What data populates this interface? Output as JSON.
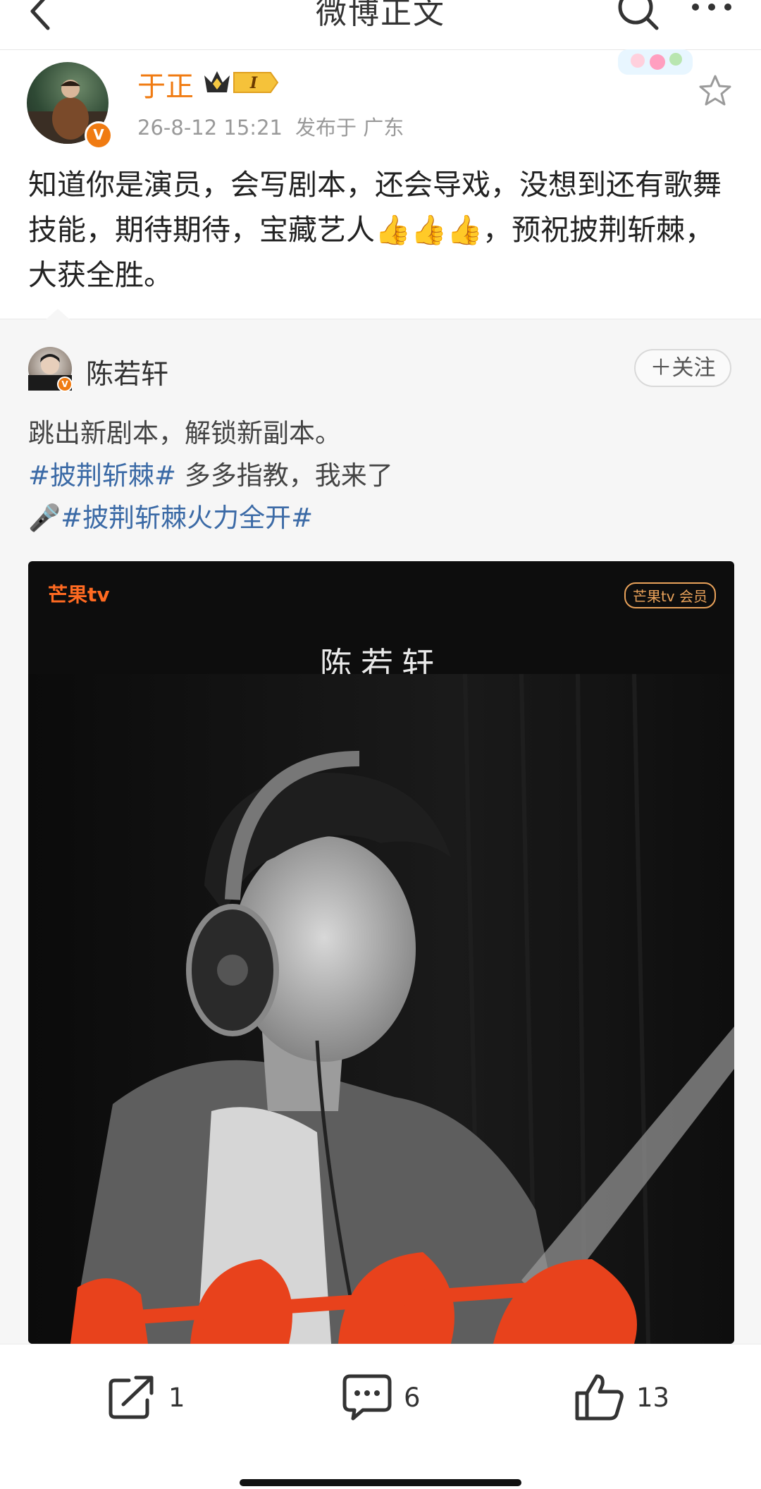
{
  "nav": {
    "title": "微博正文"
  },
  "post": {
    "author": "于正",
    "level": "I",
    "time": "26-8-12 15:21",
    "location": "发布于 广东",
    "text": "知道你是演员，会写剧本，还会导戏，没想到还有歌舞技能，期待期待，宝藏艺人👍👍👍，预祝披荆斩棘，大获全胜。"
  },
  "repost": {
    "author": "陈若轩",
    "follow_label": "关注",
    "line1": "跳出新剧本，解锁新副本。",
    "hashtag1": "#披荆斩棘#",
    "line2_rest": " 多多指教，我来了",
    "mic": "🎤",
    "hashtag2": "#披荆斩棘火力全开#",
    "poster": {
      "logo": "芒果tv",
      "vip": "芒果tv 会员",
      "name": "陈若轩"
    }
  },
  "actions": {
    "reposts": "1",
    "comments": "6",
    "likes": "13"
  },
  "colors": {
    "accent": "#f07b12",
    "hashtag": "#3b6aa6",
    "poster_red": "#e8421c"
  }
}
